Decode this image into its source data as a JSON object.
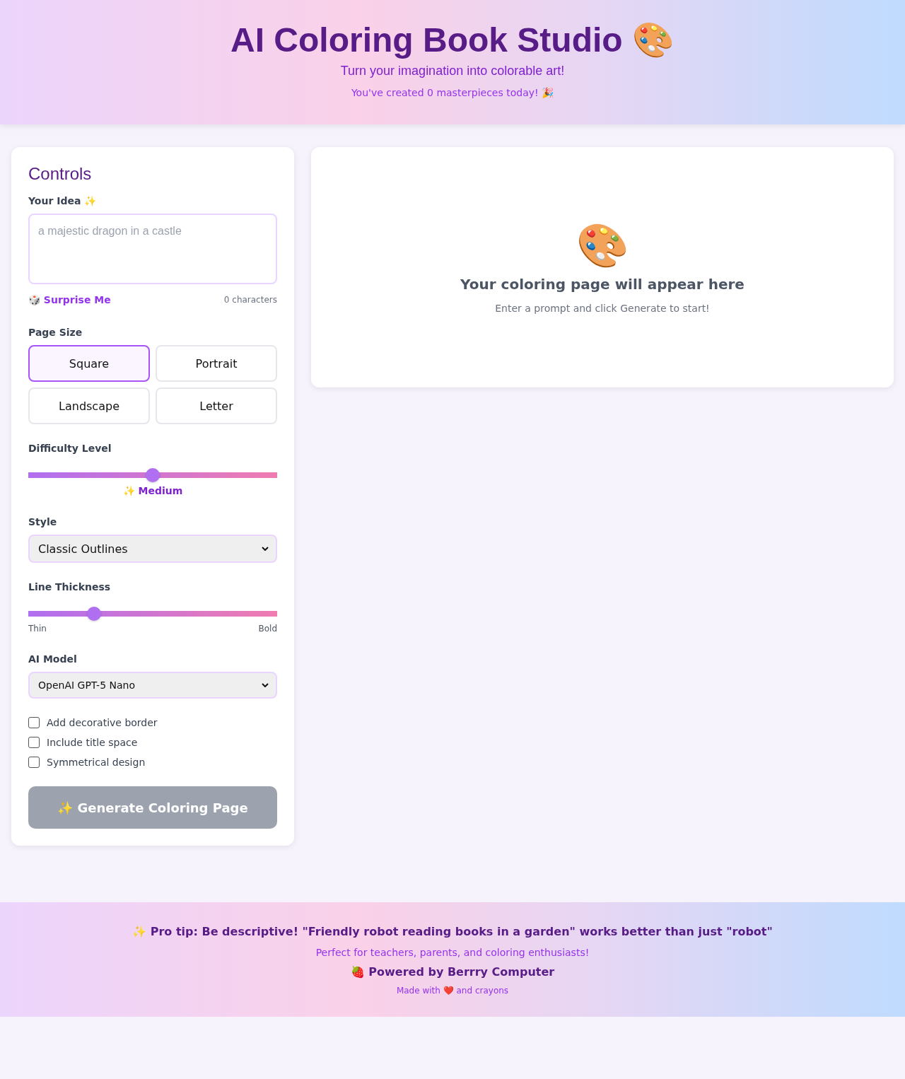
{
  "header": {
    "title": "AI Coloring Book Studio 🎨",
    "subtitle": "Turn your imagination into colorable art!",
    "counter": "You've created 0 masterpieces today! 🎉"
  },
  "controls": {
    "title": "Controls",
    "idea": {
      "label": "Your Idea ✨",
      "placeholder": "a majestic dragon in a castle",
      "surprise": "🎲 Surprise Me",
      "count": "0 characters"
    },
    "page_size": {
      "label": "Page Size",
      "options": [
        {
          "label": "Square",
          "selected": true
        },
        {
          "label": "Portrait",
          "selected": false
        },
        {
          "label": "Landscape",
          "selected": false
        },
        {
          "label": "Letter",
          "selected": false
        }
      ]
    },
    "difficulty": {
      "label": "Difficulty Level",
      "level": 0.5,
      "reading": "✨ Medium"
    },
    "style": {
      "label": "Style",
      "value": "Classic Outlines"
    },
    "thickness": {
      "label": "Line Thickness",
      "level": 0.265,
      "min_label": "Thin",
      "max_label": "Bold"
    },
    "model": {
      "label": "AI Model",
      "value": "OpenAI GPT-5 Nano"
    },
    "options": [
      {
        "label": "Add decorative border",
        "checked": false
      },
      {
        "label": "Include title space",
        "checked": false
      },
      {
        "label": "Symmetrical design",
        "checked": false
      }
    ],
    "generate": {
      "label": "✨ Generate Coloring Page",
      "disabled": true
    }
  },
  "preview": {
    "icon": "🎨",
    "title": "Your coloring page will appear here",
    "hint": "Enter a prompt and click Generate to start!"
  },
  "footer": {
    "tip": "✨ Pro tip: Be descriptive! \"Friendly robot reading books in a garden\" works better than just \"robot\"",
    "audience": "Perfect for teachers, parents, and coloring enthusiasts!",
    "powered": "🍓 Powered by Berrry Computer",
    "made": "Made with ❤️ and crayons"
  }
}
